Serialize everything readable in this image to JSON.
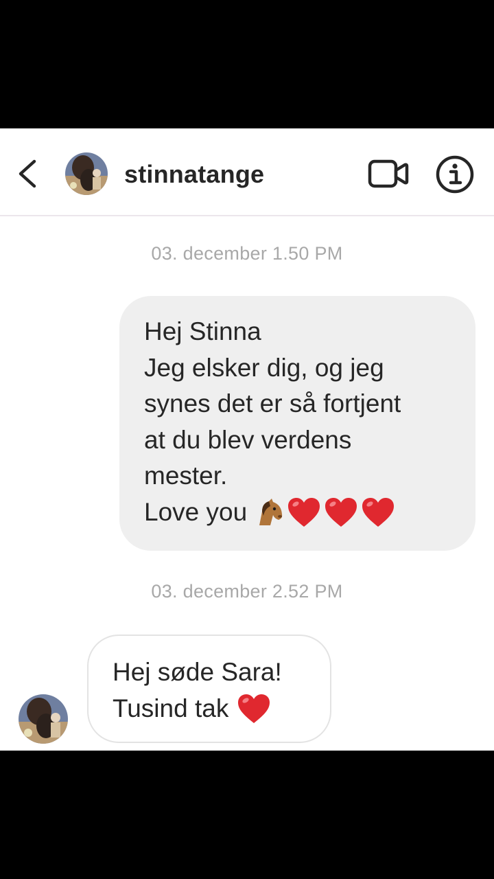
{
  "header": {
    "username": "stinnatange",
    "back_icon": "chevron-left-icon",
    "video_icon": "video-camera-icon",
    "info_icon": "info-icon"
  },
  "messages": [
    {
      "timestamp": "03. december 1.50 PM",
      "direction": "outgoing",
      "lines": [
        "Hej Stinna",
        "Jeg elsker dig, og jeg",
        "synes det er så fortjent",
        "at du blev verdens",
        "mester.",
        "Love you"
      ],
      "trailing_emoji": [
        "horse-face-emoji",
        "red-heart-emoji",
        "red-heart-emoji",
        "red-heart-emoji"
      ]
    },
    {
      "timestamp": "03. december 2.52 PM",
      "direction": "incoming",
      "lines": [
        "Hej søde Sara!",
        "Tusind tak"
      ],
      "trailing_emoji": [
        "red-heart-emoji"
      ]
    }
  ],
  "colors": {
    "text": "#262626",
    "timestamp": "#a8a8a8",
    "outgoing_bubble": "#efefef",
    "incoming_border": "#e3e3e3",
    "heart": "#e0282f"
  }
}
